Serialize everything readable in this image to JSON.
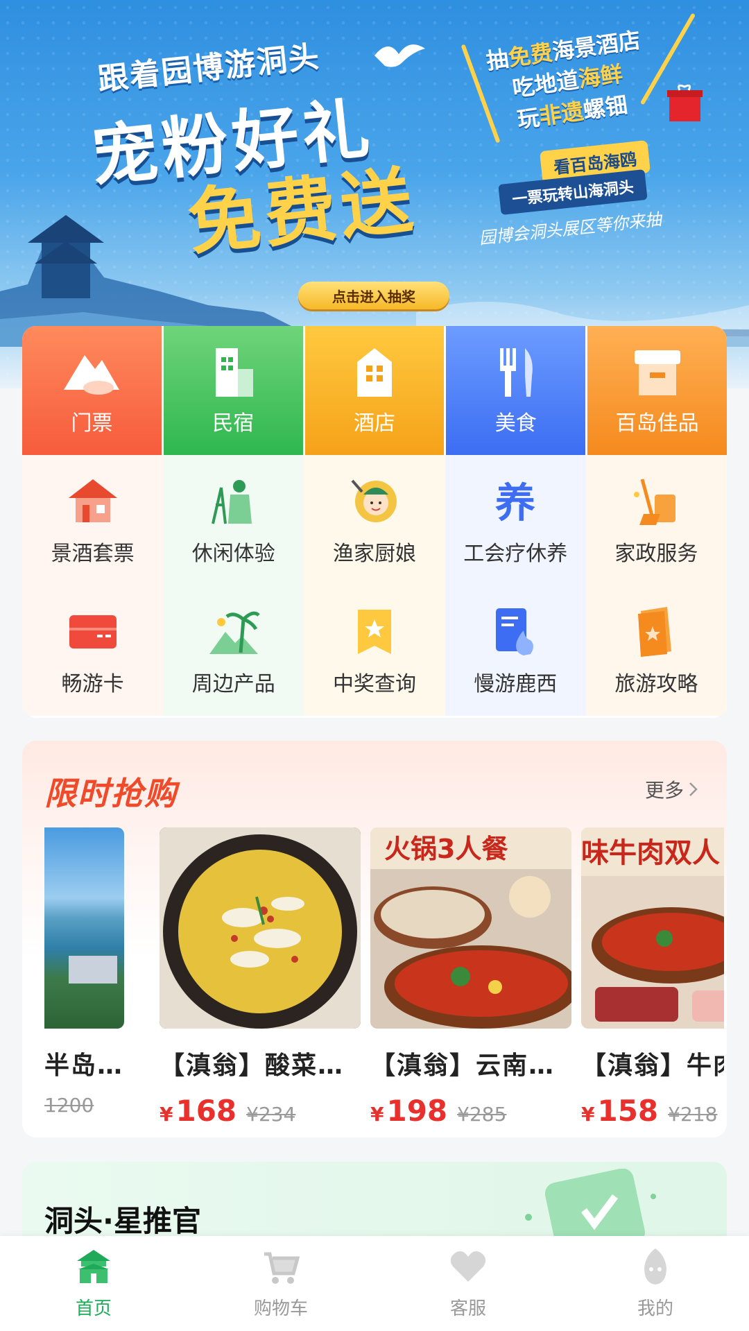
{
  "banner": {
    "subtitle": "跟着园博游洞头",
    "title_line1": "宠粉好礼",
    "title_line2": "免费送",
    "slogans": [
      {
        "pre": "抽",
        "hl": "免费",
        "post": "海景酒店"
      },
      {
        "pre": "吃地道",
        "hl": "海鲜",
        "post": ""
      },
      {
        "pre": "玩",
        "hl": "非遗",
        "post": "螺钿"
      }
    ],
    "tag1": "看百岛海鸥",
    "tag2": "一票玩转山海洞头",
    "tag3": "园博会洞头展区等你来抽",
    "cta": "点击进入抽奖"
  },
  "categories": {
    "primary": [
      {
        "label": "门票",
        "icon": "mountain-ticket-icon",
        "color": "#f65b3c"
      },
      {
        "label": "民宿",
        "icon": "homestay-building-icon",
        "color": "#2fb74f"
      },
      {
        "label": "酒店",
        "icon": "hotel-building-icon",
        "color": "#f5a219"
      },
      {
        "label": "美食",
        "icon": "fork-knife-icon",
        "color": "#3c6df2"
      },
      {
        "label": "百岛佳品",
        "icon": "shop-icon",
        "color": "#f58a1e"
      }
    ],
    "secondary": [
      {
        "label": "景酒套票",
        "icon": "pavilion-icon"
      },
      {
        "label": "休闲体验",
        "icon": "fisherman-icon"
      },
      {
        "label": "渔家厨娘",
        "icon": "chef-woman-icon"
      },
      {
        "label": "工会疗休养",
        "icon": "recuperate-character-icon"
      },
      {
        "label": "家政服务",
        "icon": "cleaning-broom-icon"
      },
      {
        "label": "畅游卡",
        "icon": "card-icon"
      },
      {
        "label": "周边产品",
        "icon": "palm-tree-icon"
      },
      {
        "label": "中奖查询",
        "icon": "prize-bookmark-icon"
      },
      {
        "label": "慢游鹿西",
        "icon": "document-fire-icon"
      },
      {
        "label": "旅游攻略",
        "icon": "guide-book-icon"
      }
    ]
  },
  "flash_sale": {
    "title": "限时抢购",
    "more": "更多",
    "products": [
      {
        "name": "半岛…",
        "currency": "",
        "price": "",
        "original": "1200"
      },
      {
        "name": "【滇翁】酸菜…",
        "currency": "¥",
        "price": "168",
        "original": "¥234"
      },
      {
        "name": "【滇翁】云南…",
        "currency": "¥",
        "price": "198",
        "original": "¥285"
      },
      {
        "name": "【滇翁】牛肉",
        "currency": "¥",
        "price": "158",
        "original": "¥218"
      }
    ],
    "image_texts": [
      "火锅3人餐",
      "味牛肉双人"
    ]
  },
  "recommend": {
    "title": "洞头·星推官"
  },
  "tabbar": [
    {
      "label": "首页",
      "icon": "home-pavilion-icon",
      "active": true
    },
    {
      "label": "购物车",
      "icon": "cart-icon",
      "active": false
    },
    {
      "label": "客服",
      "icon": "heart-service-icon",
      "active": false
    },
    {
      "label": "我的",
      "icon": "profile-icon",
      "active": false
    }
  ],
  "colors": {
    "accent_green": "#1faa59",
    "price_red": "#e8302c",
    "flash_red": "#ef4a2a"
  }
}
